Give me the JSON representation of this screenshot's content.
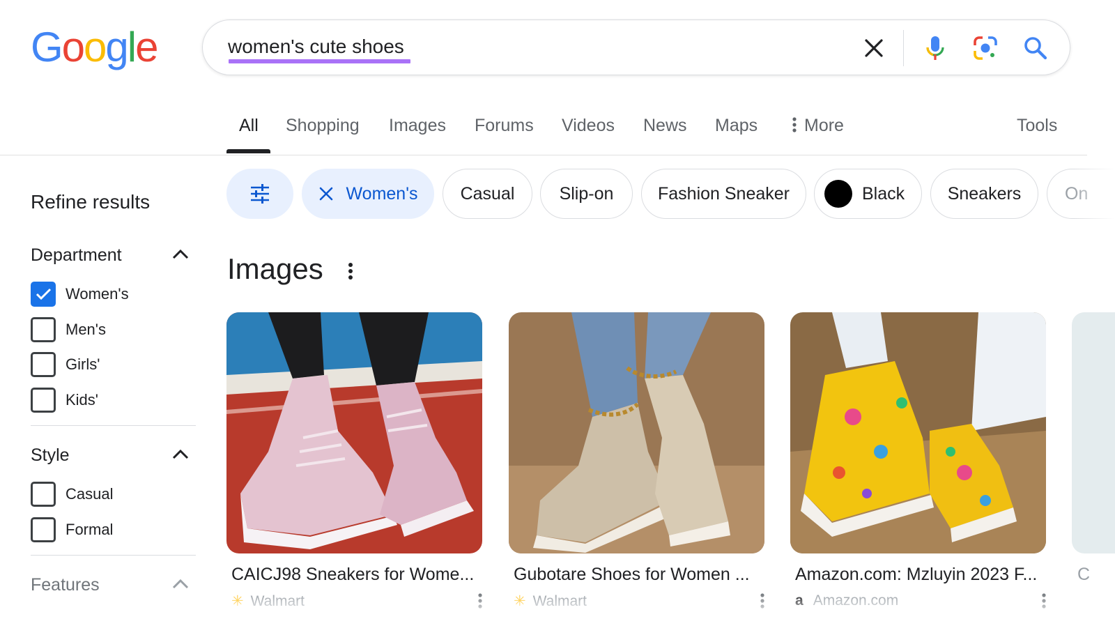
{
  "logo": {
    "letters": [
      "G",
      "o",
      "o",
      "g",
      "l",
      "e"
    ],
    "colors": [
      "#4285F4",
      "#EA4335",
      "#FBBC05",
      "#4285F4",
      "#34A853",
      "#EA4335"
    ]
  },
  "search": {
    "query": "women's cute shoes",
    "underline_color": "#a972f7",
    "icons": [
      "clear-icon",
      "microphone-icon",
      "lens-camera-icon",
      "search-icon"
    ]
  },
  "tabs": {
    "all": "All",
    "shopping": "Shopping",
    "images": "Images",
    "forums": "Forums",
    "videos": "Videos",
    "news": "News",
    "maps": "Maps",
    "more": "More",
    "tools": "Tools",
    "active": "All"
  },
  "chips": {
    "womens": "Women's",
    "casual": "Casual",
    "slipon": "Slip-on",
    "fashion": "Fashion Sneaker",
    "black": "Black",
    "sneakers": "Sneakers",
    "partial": "On"
  },
  "sidebar": {
    "title": "Refine results",
    "department": {
      "title": "Department",
      "options": [
        {
          "label": "Women's",
          "checked": true
        },
        {
          "label": "Men's",
          "checked": false
        },
        {
          "label": "Girls'",
          "checked": false
        },
        {
          "label": "Kids'",
          "checked": false
        }
      ]
    },
    "style": {
      "title": "Style",
      "options": [
        {
          "label": "Casual",
          "checked": false
        },
        {
          "label": "Formal",
          "checked": false
        }
      ]
    },
    "features": {
      "title": "Features"
    }
  },
  "images": {
    "title": "Images",
    "cards": [
      {
        "title": "CAICJ98 Sneakers for Wome...",
        "source": "Walmart"
      },
      {
        "title": "Gubotare Shoes for Women ...",
        "source": "Walmart"
      },
      {
        "title": "Amazon.com: Mzluyin 2023 F...",
        "source": "Amazon.com"
      }
    ],
    "partial_card_title": "C"
  }
}
